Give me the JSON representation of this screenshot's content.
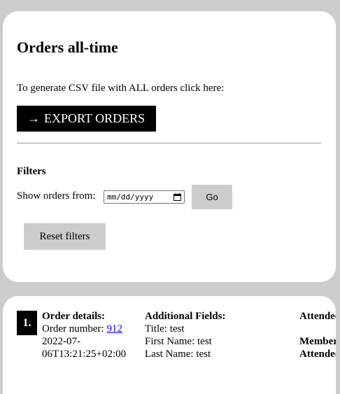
{
  "orders_card": {
    "title": "Orders all-time",
    "intro": "To generate CSV file with ALL orders click here:",
    "export_arrow": "→",
    "export_label": "EXPORT ORDERS",
    "filters_heading": "Filters",
    "show_from_label": "Show orders from:",
    "date_placeholder": "mm/dd/yyyy",
    "go_label": "Go",
    "reset_label": "Reset filters"
  },
  "order": {
    "index": "1.",
    "details_heading": "Order details:",
    "order_number_label": "Order number:",
    "order_number": "912",
    "timestamp_line1": "2022-07-",
    "timestamp_line2": "06T13:21:25+02:00",
    "additional_heading": "Additional Fields:",
    "fields": [
      "Title: test",
      "First Name: test",
      "Last Name: test"
    ],
    "attendee_heading": "Attendee",
    "member_label": "Member",
    "attendee_label": "Attendee"
  },
  "icons": {
    "date_picker": "calendar-icon"
  }
}
